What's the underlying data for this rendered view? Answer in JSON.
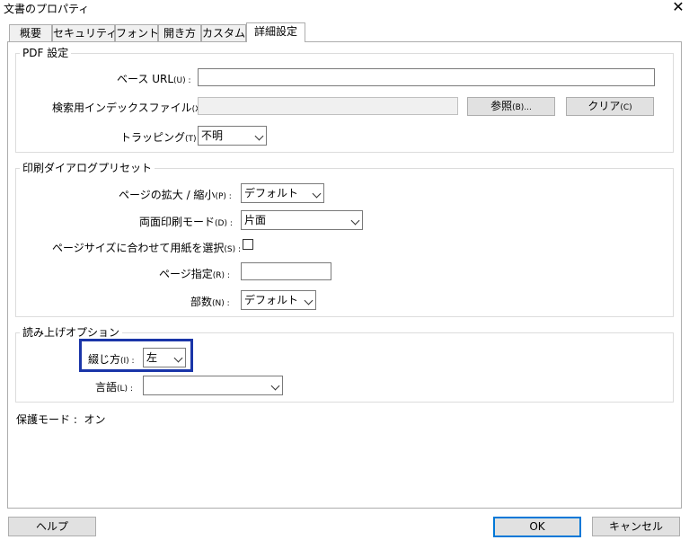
{
  "window": {
    "title": "文書のプロパティ"
  },
  "tabs": [
    "概要",
    "セキュリティ",
    "フォント",
    "開き方",
    "カスタム",
    "詳細設定"
  ],
  "pdf_settings": {
    "group_label": "PDF 設定",
    "base_url_label": "ベース URL",
    "base_url_key": "(U) :",
    "base_url_value": "",
    "index_label": "検索用インデックスファイル",
    "index_key": "(X) :",
    "index_value": "",
    "browse_button": "参照",
    "browse_key": "(B)...",
    "clear_button": "クリア",
    "clear_key": "(C)",
    "trapping_label": "トラッピング",
    "trapping_key": "(T) :",
    "trapping_value": "不明"
  },
  "print_presets": {
    "group_label": "印刷ダイアログプリセット",
    "scaling_label": "ページの拡大 / 縮小",
    "scaling_key": "(P) :",
    "scaling_value": "デフォルト",
    "duplex_label": "両面印刷モード",
    "duplex_key": "(D) :",
    "duplex_value": "片面",
    "paper_source_label": "ページサイズに合わせて用紙を選択",
    "paper_source_key": "(S) :",
    "paper_source_checked": false,
    "page_range_label": "ページ指定",
    "page_range_key": "(R) :",
    "page_range_value": "",
    "copies_label": "部数",
    "copies_key": "(N) :",
    "copies_value": "デフォルト"
  },
  "reading_options": {
    "group_label": "読み上げオプション",
    "binding_label": "綴じ方",
    "binding_key": "(I) :",
    "binding_value": "左",
    "language_label": "言語",
    "language_key": "(L) :",
    "language_value": ""
  },
  "protected_mode": "保護モード :  オン",
  "footer": {
    "help": "ヘルプ",
    "ok": "OK",
    "cancel": "キャンセル"
  },
  "colors": {
    "highlight": "#1a35a8",
    "default_button_border": "#0078d7"
  }
}
